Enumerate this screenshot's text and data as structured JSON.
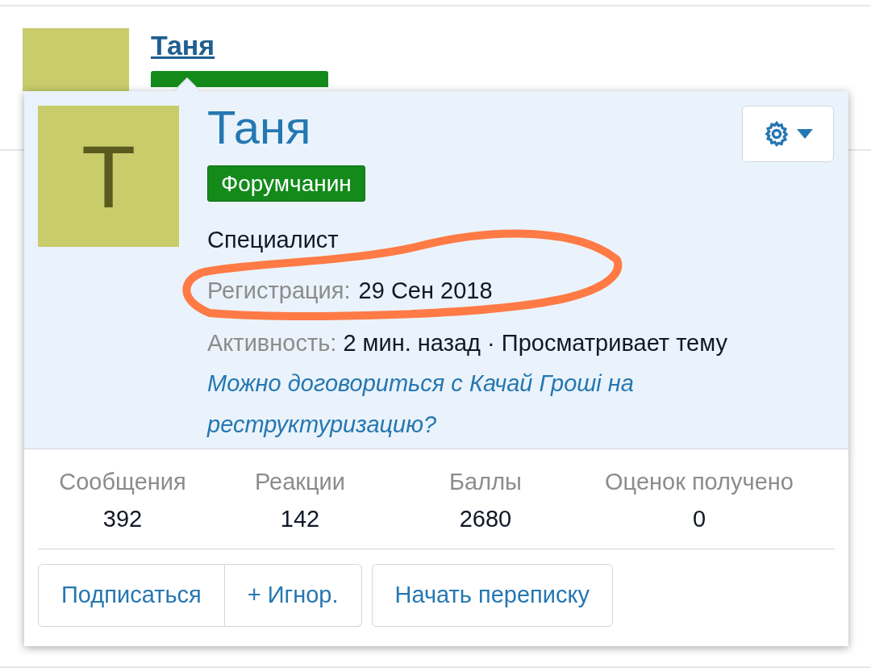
{
  "background_member": {
    "name": "Таня"
  },
  "popup": {
    "avatar_letter": "T",
    "name": "Таня",
    "badge": "Форумчанин",
    "user_title": "Специалист",
    "registration": {
      "label": "Регистрация:",
      "value": "29 Сен 2018"
    },
    "activity": {
      "label": "Активность:",
      "text": "2 мин. назад · Просматривает тему",
      "link": "Можно договориться с Качай Гроші на реструктуризацию?"
    },
    "stats": [
      {
        "label": "Сообщения",
        "value": "392"
      },
      {
        "label": "Реакции",
        "value": "142"
      },
      {
        "label": "Баллы",
        "value": "2680"
      },
      {
        "label": "Оценок получено",
        "value": "0"
      }
    ],
    "button_group": [
      "Подписаться",
      "+ Игнор."
    ],
    "buttons": [
      "Начать переписку"
    ]
  }
}
